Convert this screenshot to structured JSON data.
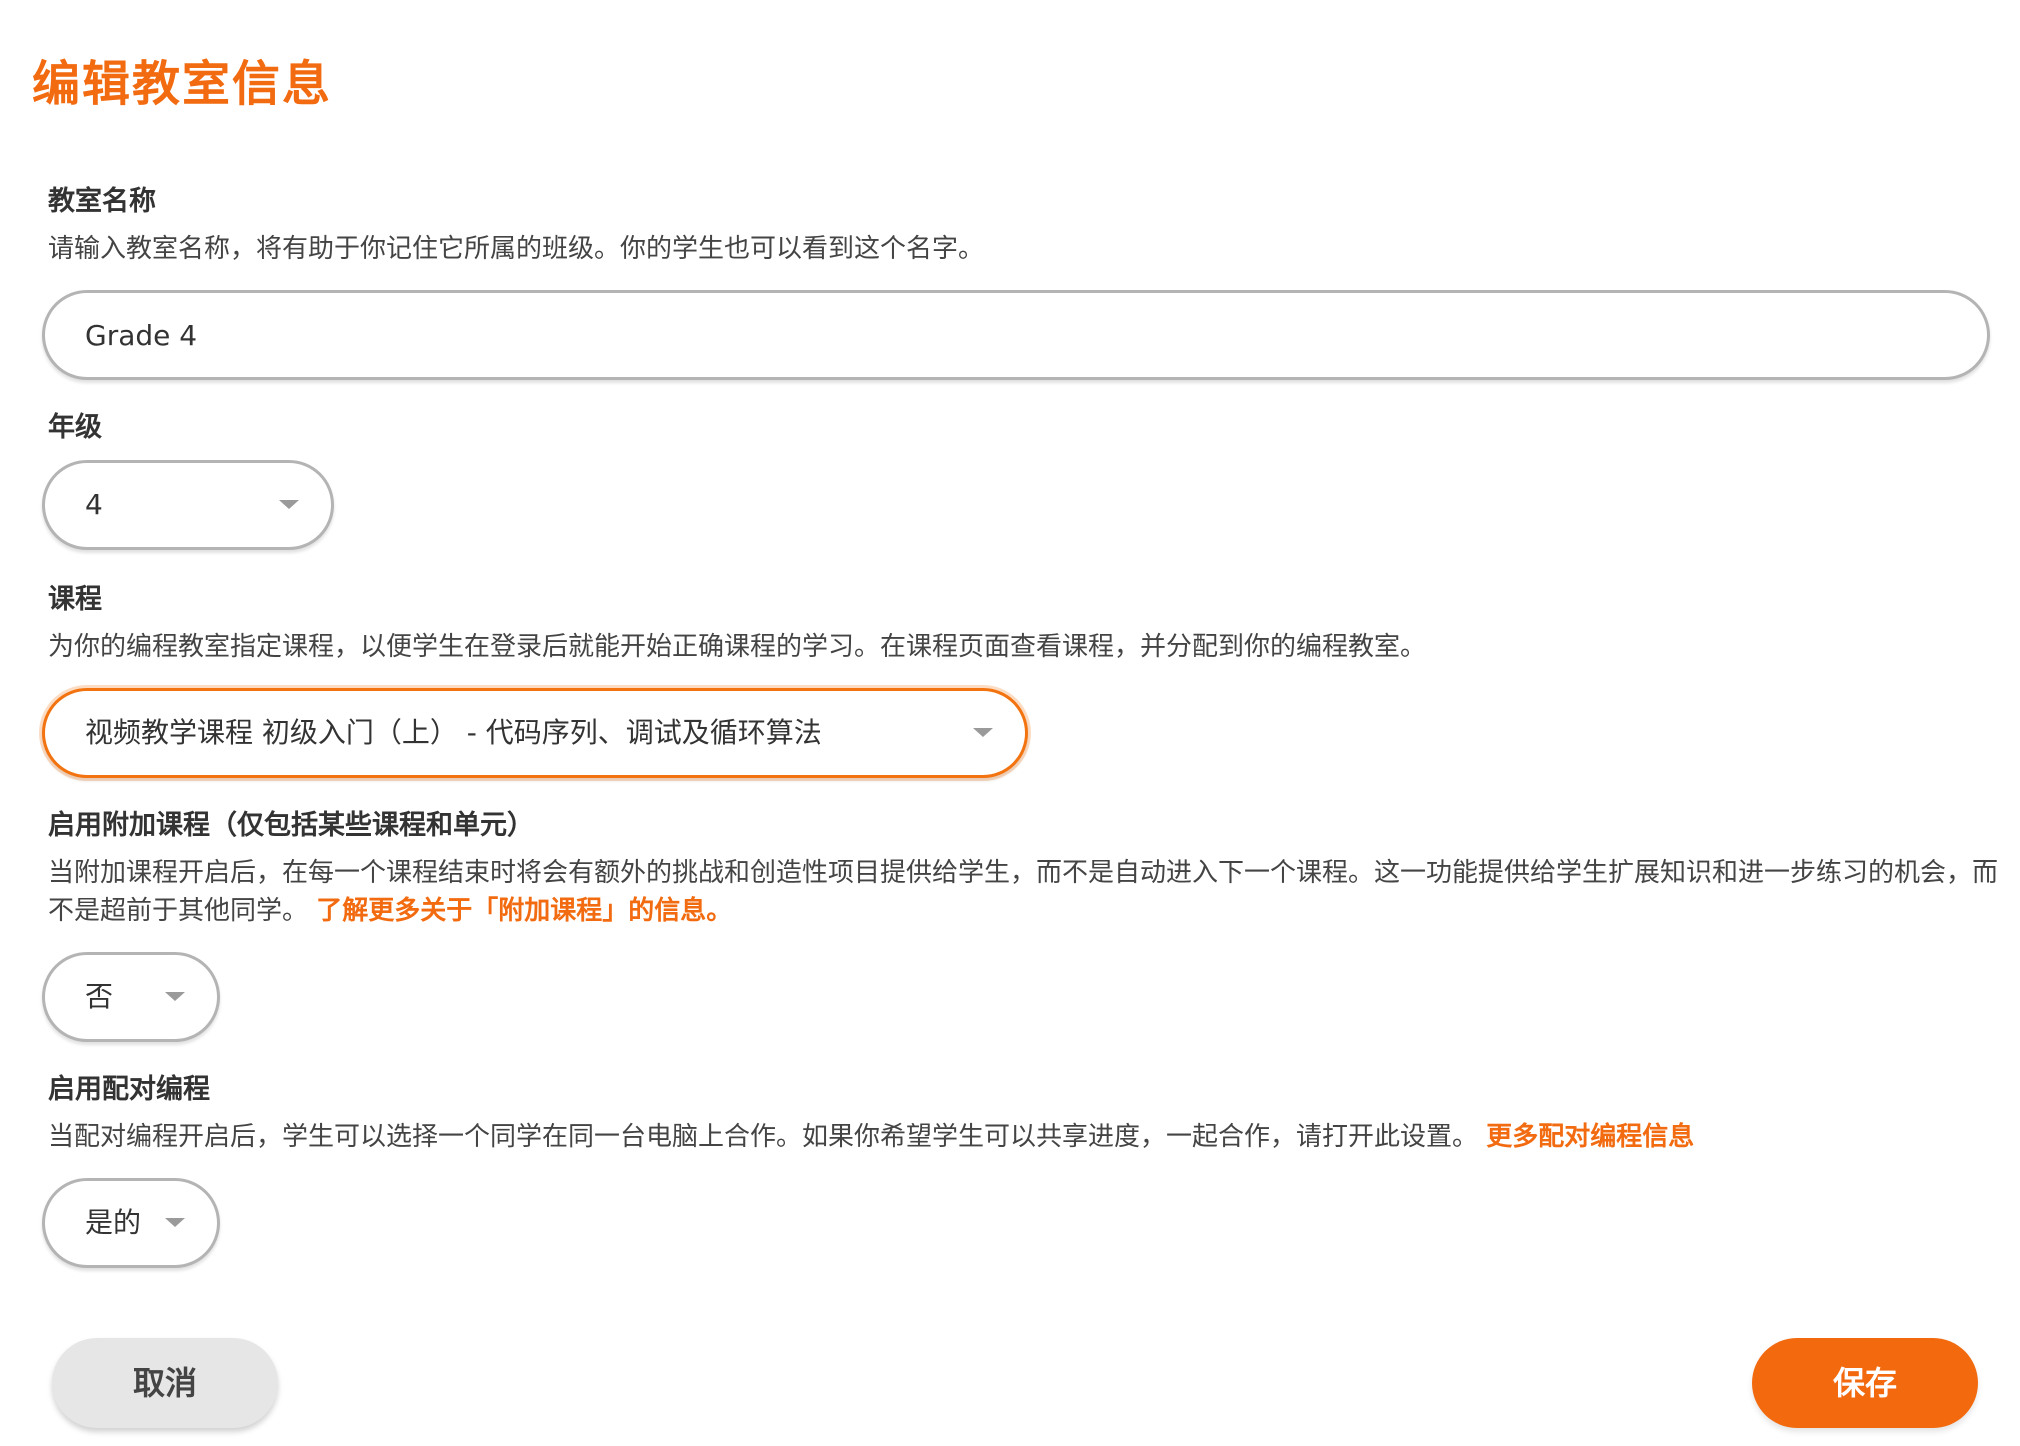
{
  "page": {
    "title": "编辑教室信息"
  },
  "classroom_name": {
    "label": "教室名称",
    "description": "请输入教室名称，将有助于你记住它所属的班级。你的学生也可以看到这个名字。",
    "value": "Grade 4"
  },
  "grade": {
    "label": "年级",
    "selected": "4"
  },
  "course": {
    "label": "课程",
    "description": "为你的编程教室指定课程，以便学生在登录后就能开始正确课程的学习。在课程页面查看课程，并分配到你的编程教室。",
    "selected": "视频教学课程 初级入门（上） - 代码序列、调试及循环算法"
  },
  "bonus_levels": {
    "label": "启用附加课程（仅包括某些课程和单元）",
    "description": "当附加课程开启后，在每一个课程结束时将会有额外的挑战和创造性项目提供给学生，而不是自动进入下一个课程。这一功能提供给学生扩展知识和进一步练习的机会，而不是超前于其他同学。",
    "link_text": "了解更多关于「附加课程」的信息。",
    "selected": "否"
  },
  "pair_programming": {
    "label": "启用配对编程",
    "description": "当配对编程开启后，学生可以选择一个同学在同一台电脑上合作。如果你希望学生可以共享进度，一起合作，请打开此设置。",
    "link_text": "更多配对编程信息",
    "selected": "是的"
  },
  "actions": {
    "cancel_label": "取消",
    "save_label": "保存"
  },
  "colors": {
    "accent": "#f26b11",
    "text": "#333333",
    "border": "#b4b4b4",
    "cancel_bg": "#e6e6e6"
  }
}
